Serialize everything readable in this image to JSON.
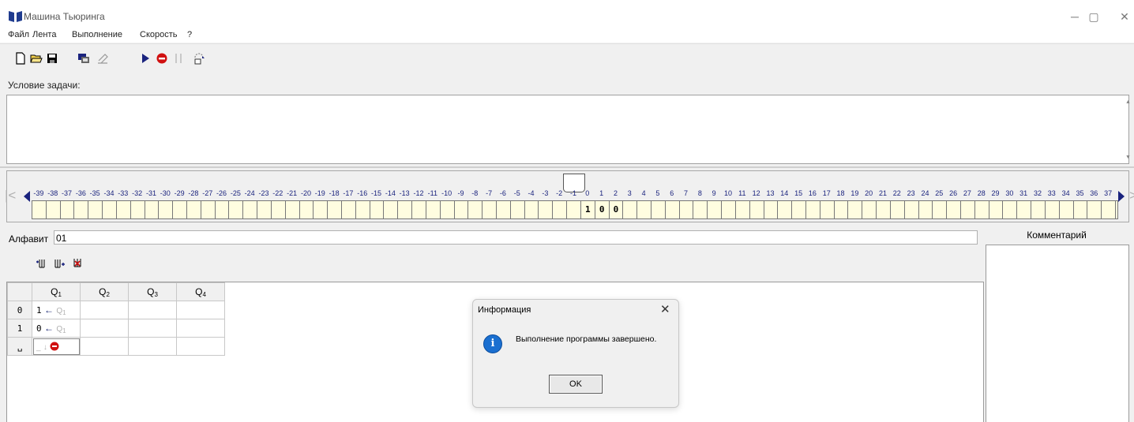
{
  "window": {
    "title": "Машина Тьюринга",
    "min": "─",
    "max": "▢",
    "close": "✕"
  },
  "menu": [
    "Файл",
    "Лента",
    "Выполнение",
    "Скорость",
    "?"
  ],
  "task": {
    "label": "Условие задачи:",
    "text": ""
  },
  "tape": {
    "first_index": -39,
    "last_index": 37,
    "head_index": -1,
    "cells": {
      "0": "1",
      "1": "0",
      "2": "0"
    }
  },
  "alphabet": {
    "label": "Алфавит",
    "value": "01"
  },
  "table": {
    "states": [
      "1",
      "2",
      "3",
      "4"
    ],
    "state_prefix": "Q",
    "rows": [
      {
        "symbol": "0",
        "Q1": {
          "write": "1",
          "move": "←",
          "next": "Q1"
        }
      },
      {
        "symbol": "1",
        "Q1": {
          "write": "0",
          "move": "←",
          "next": "Q1"
        }
      },
      {
        "symbol": "␣",
        "Q1": {
          "write": "_",
          "move": "↓",
          "next": "stop"
        }
      }
    ]
  },
  "comment": {
    "title": "Комментарий"
  },
  "dialog": {
    "title": "Информация",
    "message": "Выполнение программы завершено.",
    "ok": "OK",
    "icon": "i"
  }
}
